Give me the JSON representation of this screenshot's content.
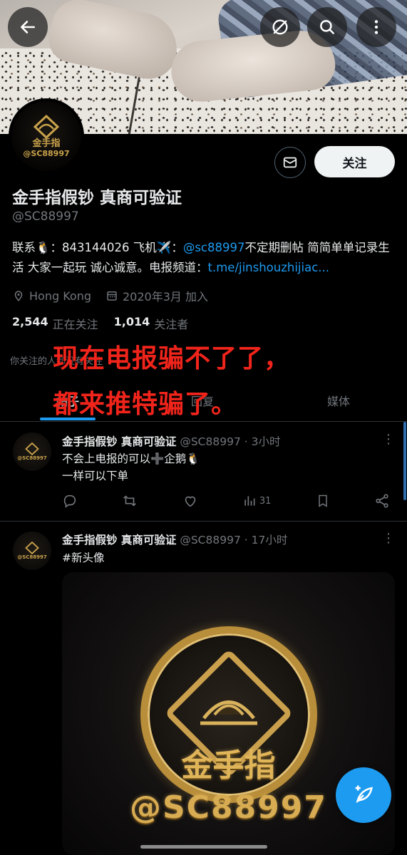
{
  "profile": {
    "name": "金手指假钞 真商可验证",
    "handle": "@SC88997",
    "bio_part1": "联系🐧：843144026 飞机✈️：",
    "bio_link": "@sc88997",
    "bio_part2": "不定期删帖 简简单单记录生活 大家一起玩 诚心诚意。电报频道：",
    "bio_url": "t.me/jinshouzhijiac...",
    "location": "Hong Kong",
    "joined": "2020年3月 加入",
    "following_count": "2,544",
    "following_label": "正在关注",
    "followers_count": "1,014",
    "followers_label": "关注者",
    "followed_by_text": "你关注的",
    "followed_by_tail": "人都没有关注",
    "follow_button": "关注",
    "avatar_text_cn": "金手指",
    "avatar_text_en": "@SC88997"
  },
  "tabs": [
    {
      "label": "帖子"
    },
    {
      "label": "回复"
    },
    {
      "label": "媒体"
    }
  ],
  "overlay": {
    "line1": "现在电报骗不了了，",
    "line2": "都来推特骗了。"
  },
  "tweets": [
    {
      "name": "金手指假钞 真商可验证",
      "handle": "@SC88997 · 3小时",
      "text_line1": "不会上电报的可以➕企鹅🐧",
      "text_line2": "一样可以下单",
      "views": "31"
    },
    {
      "name": "金手指假钞 真商可验证",
      "handle": "@SC88997 · 17小时",
      "hashtag": "#新头像",
      "media_text_cn": "金手指",
      "media_text_en": "@SC88997"
    }
  ],
  "icons": {
    "back": "arrow-left-icon",
    "hide": "eye-off-icon",
    "search": "search-icon",
    "more": "more-vertical-icon",
    "message": "mail-icon",
    "compose": "compose-icon"
  },
  "colors": {
    "accent": "#1d9bf0",
    "overlay_red": "#f0241b",
    "gold": "#c9a24b"
  }
}
